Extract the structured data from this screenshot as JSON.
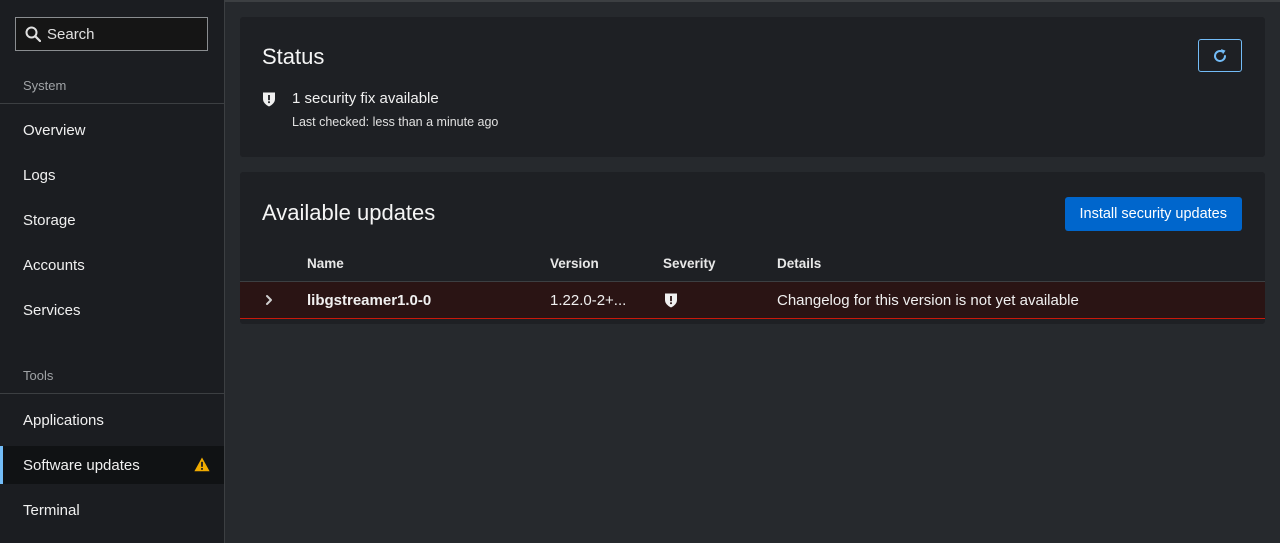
{
  "sidebar": {
    "search_placeholder": "Search",
    "sections": [
      {
        "title": "System",
        "items": [
          {
            "label": "Overview"
          },
          {
            "label": "Logs"
          },
          {
            "label": "Storage"
          },
          {
            "label": "Accounts"
          },
          {
            "label": "Services"
          }
        ]
      },
      {
        "title": "Tools",
        "items": [
          {
            "label": "Applications"
          },
          {
            "label": "Software updates",
            "active": true,
            "badge_icon": "warning-icon"
          },
          {
            "label": "Terminal"
          }
        ]
      }
    ]
  },
  "status": {
    "title": "Status",
    "refresh_icon": "refresh-icon",
    "fix_icon": "shield-icon",
    "fix_text": "1 security fix available",
    "last_checked": "Last checked: less than a minute ago"
  },
  "updates": {
    "title": "Available updates",
    "install_label": "Install security updates",
    "columns": [
      "Name",
      "Version",
      "Severity",
      "Details"
    ],
    "rows": [
      {
        "name": "libgstreamer1.0-0",
        "version": "1.22.0-2+...",
        "severity_icon": "shield-icon",
        "details": "Changelog for this version is not yet available"
      }
    ]
  },
  "colors": {
    "accent": "#73bcf7",
    "primary_button": "#0066cc",
    "danger": "#c9190b",
    "warning": "#f0ab00"
  }
}
